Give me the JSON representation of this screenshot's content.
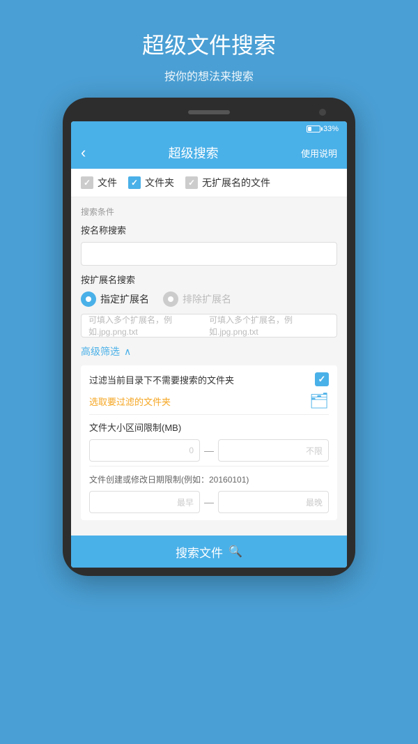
{
  "page": {
    "title": "超级文件搜索",
    "subtitle": "按你的想法来搜索"
  },
  "status_bar": {
    "battery_percent": "33%"
  },
  "app_header": {
    "title": "超级搜索",
    "help_label": "使用说明",
    "back_icon": "‹"
  },
  "filter_tabs": {
    "tab1": "文件",
    "tab2": "文件夹",
    "tab3": "无扩展名的文件"
  },
  "search_section": {
    "conditions_label": "搜索条件",
    "name_search_label": "按名称搜索",
    "name_input_placeholder": "",
    "ext_search_label": "按扩展名搜索",
    "radio1": "指定扩展名",
    "radio2": "排除扩展名",
    "ext_input_placeholder": "可填入多个扩展名，例如.jpg.png.txt"
  },
  "advanced": {
    "label": "高级筛选",
    "chevron": "∧",
    "filter_folder_label": "过滤当前目录下不需要搜索的文件夹",
    "select_folder_label": "选取要过滤的文件夹",
    "folder_icon": "📁",
    "size_label": "文件大小区间限制(MB)",
    "size_from": "0",
    "size_to_placeholder": "不限",
    "date_label": "文件创建或修改日期限制(例如：20160101)",
    "date_from_placeholder": "最早",
    "date_to_placeholder": "最晚"
  },
  "search_button": {
    "label": "搜索文件",
    "icon": "🔍"
  }
}
